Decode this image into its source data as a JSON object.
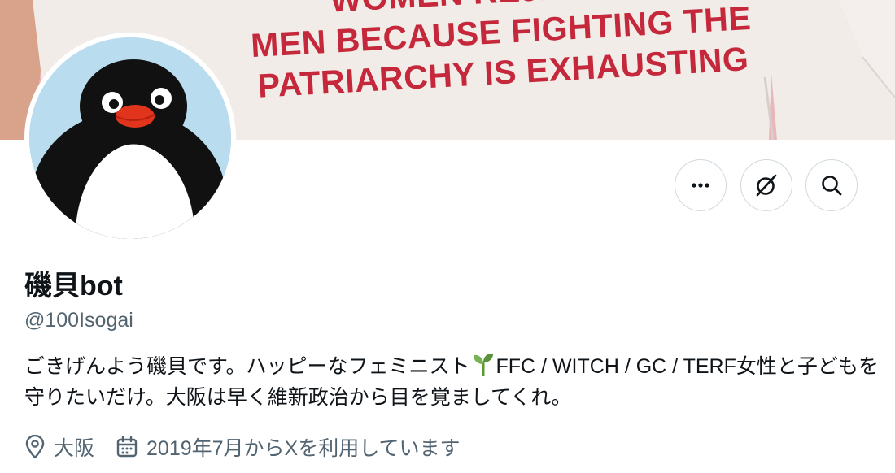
{
  "banner": {
    "lines": [
      "WOMEN REJECTING",
      "MEN BECAUSE FIGHTING THE",
      "PATRIARCHY IS EXHAUSTING"
    ]
  },
  "profile": {
    "name": "磯貝bot",
    "handle": "@100Isogai",
    "bio_part1": "ごきげんよう磯貝です。ハッピーなフェミニスト",
    "bio_part2": "FFC / WITCH / GC / TERF女性と子どもを守りたいだけ。大阪は早く維新政治から目を覚ましてくれ。",
    "location": "大阪",
    "joined": "2019年7月からXを利用しています"
  },
  "actions": {
    "more_icon": "more-horizontal-icon",
    "grok_icon": "grok-icon",
    "search_icon": "search-icon"
  },
  "colors": {
    "shirt_text": "#c4283a",
    "banner_bg": "#e8b9bc",
    "avatar_bg": "#b9dcef",
    "secondary_text": "#536471",
    "border": "#cfd9de"
  }
}
